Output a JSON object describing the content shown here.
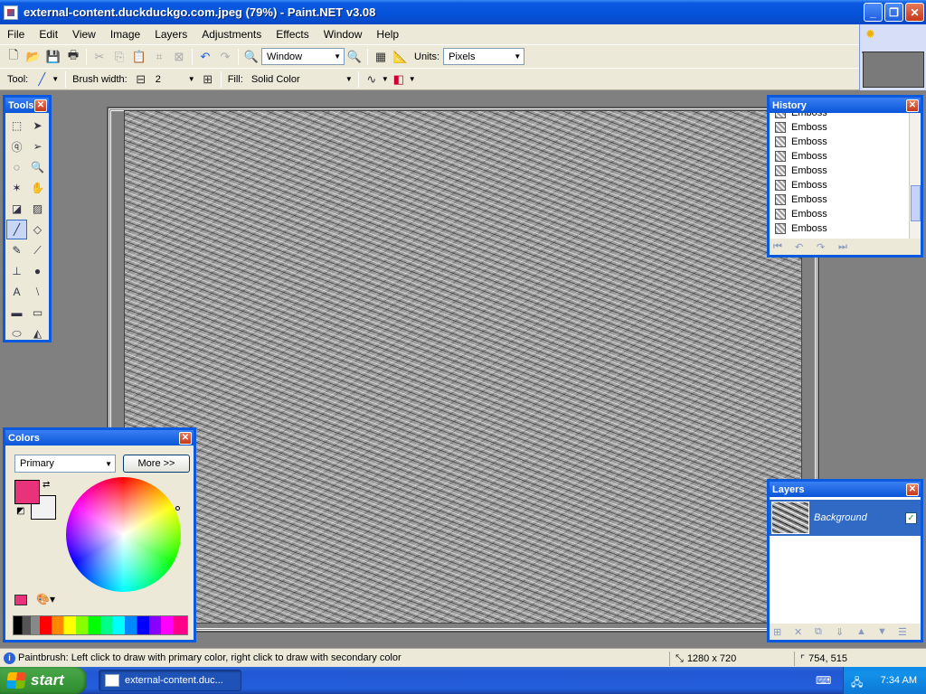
{
  "window": {
    "title": "external-content.duckduckgo.com.jpeg (79%) - Paint.NET v3.08",
    "minimize": "_",
    "maximize": "❐",
    "close": "✕"
  },
  "menu": [
    "File",
    "Edit",
    "View",
    "Image",
    "Layers",
    "Adjustments",
    "Effects",
    "Window",
    "Help"
  ],
  "toolbar": {
    "zoom_value": "Window",
    "units_label": "Units:",
    "units_value": "Pixels",
    "tool_label": "Tool:",
    "brush_width_label": "Brush width:",
    "brush_width_value": "2",
    "fill_label": "Fill:",
    "fill_value": "Solid Color"
  },
  "tools_panel": {
    "title": "Tools",
    "tools": [
      {
        "name": "rectangle-select",
        "glyph": "⬚"
      },
      {
        "name": "move-selection",
        "glyph": "➤"
      },
      {
        "name": "lasso-select",
        "glyph": "ⓠ"
      },
      {
        "name": "move-selected",
        "glyph": "➢"
      },
      {
        "name": "ellipse-select",
        "glyph": "◌"
      },
      {
        "name": "zoom",
        "glyph": "🔍"
      },
      {
        "name": "magic-wand",
        "glyph": "✶"
      },
      {
        "name": "pan",
        "glyph": "✋"
      },
      {
        "name": "paint-bucket",
        "glyph": "◪"
      },
      {
        "name": "gradient",
        "glyph": "▨"
      },
      {
        "name": "paintbrush",
        "glyph": "╱"
      },
      {
        "name": "eraser",
        "glyph": "◇"
      },
      {
        "name": "pencil",
        "glyph": "✎"
      },
      {
        "name": "color-picker",
        "glyph": "⟋"
      },
      {
        "name": "clone-stamp",
        "glyph": "⊥"
      },
      {
        "name": "recolor",
        "glyph": "●"
      },
      {
        "name": "text",
        "glyph": "A"
      },
      {
        "name": "line-curve",
        "glyph": "⧵"
      },
      {
        "name": "rectangle",
        "glyph": "▬"
      },
      {
        "name": "rounded-rectangle",
        "glyph": "▭"
      },
      {
        "name": "ellipse",
        "glyph": "⬭"
      },
      {
        "name": "freeform-shape",
        "glyph": "◭"
      }
    ],
    "selected_index": 10
  },
  "history_panel": {
    "title": "History",
    "items": [
      "Emboss",
      "Emboss",
      "Emboss",
      "Emboss",
      "Emboss",
      "Emboss",
      "Emboss",
      "Emboss",
      "Emboss"
    ]
  },
  "colors_panel": {
    "title": "Colors",
    "mode": "Primary",
    "more_button": "More >>",
    "primary_color": "#e8327a",
    "secondary_color": "#f2f2f2"
  },
  "layers_panel": {
    "title": "Layers",
    "layers": [
      {
        "name": "Background",
        "visible": true
      }
    ]
  },
  "statusbar": {
    "message": "Paintbrush: Left click to draw with primary color, right click to draw with secondary color",
    "image_size": "1280 x 720",
    "cursor_pos": "754, 515"
  },
  "taskbar": {
    "start_label": "start",
    "task_item": "external-content.duc...",
    "clock": "7:34 AM"
  }
}
